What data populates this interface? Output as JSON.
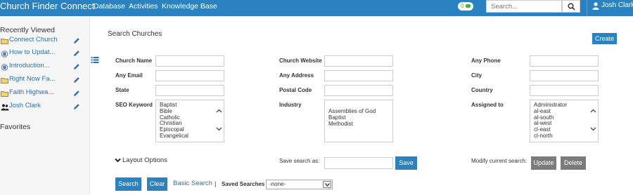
{
  "header": {
    "brand": "Church Finder Connect",
    "nav": [
      "Database",
      "Activities",
      "Knowledge Base"
    ],
    "chat_count": "0",
    "search_placeholder": "Search...",
    "user_name": "Josh Clark"
  },
  "sidebar": {
    "recently_viewed_title": "Recently Viewed",
    "items": [
      {
        "label": "Connect Church",
        "icon": "folder-icon"
      },
      {
        "label": "How to Updat...",
        "icon": "document-icon"
      },
      {
        "label": "Introduction...",
        "icon": "document-icon"
      },
      {
        "label": "Right Now Fa...",
        "icon": "folder-icon"
      },
      {
        "label": "Faith Highwa...",
        "icon": "folder-icon"
      },
      {
        "label": "Josh Clark",
        "icon": "users-icon"
      }
    ],
    "favorites_title": "Favorites"
  },
  "main": {
    "title": "Search Churches",
    "create_label": "Create",
    "fields": {
      "church_name": "Church Name",
      "church_website": "Church Website",
      "any_phone": "Any Phone",
      "any_email": "Any Email",
      "any_address": "Any Address",
      "city": "City",
      "state": "State",
      "postal_code": "Postal Code",
      "country": "Country",
      "seo_keyword": "SEO Keyword",
      "industry": "Industry",
      "assigned_to": "Assigned to"
    },
    "seo_options": [
      "Baptist",
      "Bible",
      "Catholic",
      "Christian",
      "Episcopal",
      "Evangelical"
    ],
    "industry_options": [
      "Assemblies of God",
      "Baptist",
      "Methodist"
    ],
    "assigned_options": [
      "Administrator",
      "al-east",
      "al-south",
      "al-west",
      "cl-east",
      "cl-north"
    ],
    "layout_options_label": "Layout Options",
    "save_search_label": "Save search as:",
    "save_label": "Save",
    "modify_label": "Modify current search:",
    "update_label": "Update",
    "delete_label": "Delete",
    "search_label": "Search",
    "clear_label": "Clear",
    "basic_search_label": "Basic Search",
    "separator": "|",
    "saved_searches_label": "Saved Searches",
    "saved_searches_value": "-none-"
  },
  "colors": {
    "accent": "#2a83c0",
    "link": "#2a6fb0",
    "gray_button": "#7b7b7b",
    "badge_green": "#4cae4c"
  }
}
